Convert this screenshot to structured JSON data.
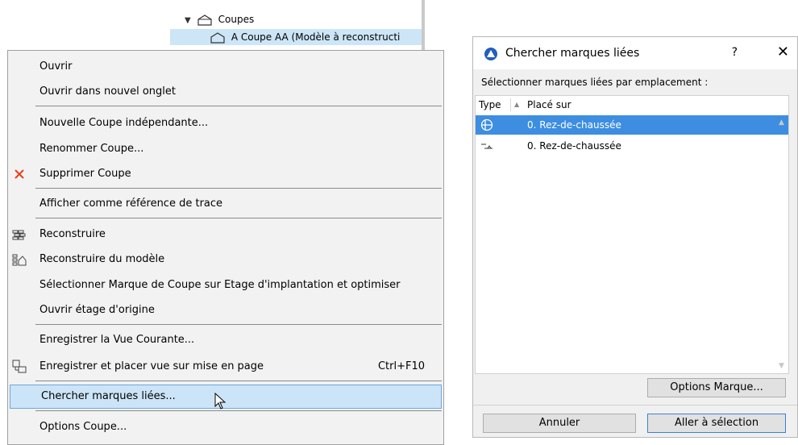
{
  "tree": {
    "parent_label": "Coupes",
    "child_label": "A Coupe AA (Modèle à reconstructi"
  },
  "menu": {
    "items": [
      {
        "label": "Ouvrir"
      },
      {
        "label": "Ouvrir dans nouvel onglet"
      },
      {
        "label": "Nouvelle Coupe indépendante..."
      },
      {
        "label": "Renommer Coupe..."
      },
      {
        "label": "Supprimer Coupe",
        "icon": "delete-x-icon"
      },
      {
        "label": "Afficher comme référence de trace"
      },
      {
        "label": "Reconstruire",
        "icon": "rebuild-icon"
      },
      {
        "label": "Reconstruire du modèle",
        "icon": "rebuild-from-model-icon"
      },
      {
        "label": "Sélectionner Marque de Coupe sur Etage d'implantation et optimiser"
      },
      {
        "label": "Ouvrir étage d'origine"
      },
      {
        "label": "Enregistrer la Vue Courante..."
      },
      {
        "label": "Enregistrer et placer vue sur mise en page",
        "shortcut": "Ctrl+F10",
        "icon": "save-place-view-icon"
      },
      {
        "label": "Chercher marques liées...",
        "state": "hover"
      },
      {
        "label": "Options Coupe..."
      }
    ]
  },
  "dialog": {
    "title": "Chercher marques liées",
    "help": "?",
    "close": "✕",
    "subtitle": "Sélectionner marques liées par emplacement :",
    "columns": [
      "Type",
      "Placé sur"
    ],
    "rows": [
      {
        "label": "0. Rez-de-chaussée",
        "icon": "section-marker-icon",
        "selected": true
      },
      {
        "label": "0. Rez-de-chaussée",
        "icon": "elevation-marker-icon",
        "selected": false
      }
    ],
    "options_button": "Options Marque...",
    "cancel_button": "Annuler",
    "goto_button": "Aller à sélection"
  },
  "colors": {
    "menu_hover": "#cce4f7",
    "list_selected": "#3d8ee0",
    "delete_icon": "#e8401c"
  }
}
